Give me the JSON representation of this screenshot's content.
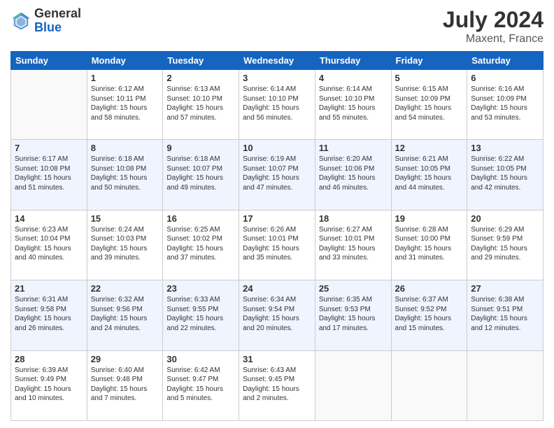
{
  "header": {
    "logo_general": "General",
    "logo_blue": "Blue",
    "month_year": "July 2024",
    "location": "Maxent, France"
  },
  "weekdays": [
    "Sunday",
    "Monday",
    "Tuesday",
    "Wednesday",
    "Thursday",
    "Friday",
    "Saturday"
  ],
  "weeks": [
    [
      {
        "day": "",
        "empty": true
      },
      {
        "day": "1",
        "line1": "Sunrise: 6:12 AM",
        "line2": "Sunset: 10:11 PM",
        "line3": "Daylight: 15 hours",
        "line4": "and 58 minutes."
      },
      {
        "day": "2",
        "line1": "Sunrise: 6:13 AM",
        "line2": "Sunset: 10:10 PM",
        "line3": "Daylight: 15 hours",
        "line4": "and 57 minutes."
      },
      {
        "day": "3",
        "line1": "Sunrise: 6:14 AM",
        "line2": "Sunset: 10:10 PM",
        "line3": "Daylight: 15 hours",
        "line4": "and 56 minutes."
      },
      {
        "day": "4",
        "line1": "Sunrise: 6:14 AM",
        "line2": "Sunset: 10:10 PM",
        "line3": "Daylight: 15 hours",
        "line4": "and 55 minutes."
      },
      {
        "day": "5",
        "line1": "Sunrise: 6:15 AM",
        "line2": "Sunset: 10:09 PM",
        "line3": "Daylight: 15 hours",
        "line4": "and 54 minutes."
      },
      {
        "day": "6",
        "line1": "Sunrise: 6:16 AM",
        "line2": "Sunset: 10:09 PM",
        "line3": "Daylight: 15 hours",
        "line4": "and 53 minutes."
      }
    ],
    [
      {
        "day": "7",
        "line1": "Sunrise: 6:17 AM",
        "line2": "Sunset: 10:08 PM",
        "line3": "Daylight: 15 hours",
        "line4": "and 51 minutes."
      },
      {
        "day": "8",
        "line1": "Sunrise: 6:18 AM",
        "line2": "Sunset: 10:08 PM",
        "line3": "Daylight: 15 hours",
        "line4": "and 50 minutes."
      },
      {
        "day": "9",
        "line1": "Sunrise: 6:18 AM",
        "line2": "Sunset: 10:07 PM",
        "line3": "Daylight: 15 hours",
        "line4": "and 49 minutes."
      },
      {
        "day": "10",
        "line1": "Sunrise: 6:19 AM",
        "line2": "Sunset: 10:07 PM",
        "line3": "Daylight: 15 hours",
        "line4": "and 47 minutes."
      },
      {
        "day": "11",
        "line1": "Sunrise: 6:20 AM",
        "line2": "Sunset: 10:06 PM",
        "line3": "Daylight: 15 hours",
        "line4": "and 46 minutes."
      },
      {
        "day": "12",
        "line1": "Sunrise: 6:21 AM",
        "line2": "Sunset: 10:05 PM",
        "line3": "Daylight: 15 hours",
        "line4": "and 44 minutes."
      },
      {
        "day": "13",
        "line1": "Sunrise: 6:22 AM",
        "line2": "Sunset: 10:05 PM",
        "line3": "Daylight: 15 hours",
        "line4": "and 42 minutes."
      }
    ],
    [
      {
        "day": "14",
        "line1": "Sunrise: 6:23 AM",
        "line2": "Sunset: 10:04 PM",
        "line3": "Daylight: 15 hours",
        "line4": "and 40 minutes."
      },
      {
        "day": "15",
        "line1": "Sunrise: 6:24 AM",
        "line2": "Sunset: 10:03 PM",
        "line3": "Daylight: 15 hours",
        "line4": "and 39 minutes."
      },
      {
        "day": "16",
        "line1": "Sunrise: 6:25 AM",
        "line2": "Sunset: 10:02 PM",
        "line3": "Daylight: 15 hours",
        "line4": "and 37 minutes."
      },
      {
        "day": "17",
        "line1": "Sunrise: 6:26 AM",
        "line2": "Sunset: 10:01 PM",
        "line3": "Daylight: 15 hours",
        "line4": "and 35 minutes."
      },
      {
        "day": "18",
        "line1": "Sunrise: 6:27 AM",
        "line2": "Sunset: 10:01 PM",
        "line3": "Daylight: 15 hours",
        "line4": "and 33 minutes."
      },
      {
        "day": "19",
        "line1": "Sunrise: 6:28 AM",
        "line2": "Sunset: 10:00 PM",
        "line3": "Daylight: 15 hours",
        "line4": "and 31 minutes."
      },
      {
        "day": "20",
        "line1": "Sunrise: 6:29 AM",
        "line2": "Sunset: 9:59 PM",
        "line3": "Daylight: 15 hours",
        "line4": "and 29 minutes."
      }
    ],
    [
      {
        "day": "21",
        "line1": "Sunrise: 6:31 AM",
        "line2": "Sunset: 9:58 PM",
        "line3": "Daylight: 15 hours",
        "line4": "and 26 minutes."
      },
      {
        "day": "22",
        "line1": "Sunrise: 6:32 AM",
        "line2": "Sunset: 9:56 PM",
        "line3": "Daylight: 15 hours",
        "line4": "and 24 minutes."
      },
      {
        "day": "23",
        "line1": "Sunrise: 6:33 AM",
        "line2": "Sunset: 9:55 PM",
        "line3": "Daylight: 15 hours",
        "line4": "and 22 minutes."
      },
      {
        "day": "24",
        "line1": "Sunrise: 6:34 AM",
        "line2": "Sunset: 9:54 PM",
        "line3": "Daylight: 15 hours",
        "line4": "and 20 minutes."
      },
      {
        "day": "25",
        "line1": "Sunrise: 6:35 AM",
        "line2": "Sunset: 9:53 PM",
        "line3": "Daylight: 15 hours",
        "line4": "and 17 minutes."
      },
      {
        "day": "26",
        "line1": "Sunrise: 6:37 AM",
        "line2": "Sunset: 9:52 PM",
        "line3": "Daylight: 15 hours",
        "line4": "and 15 minutes."
      },
      {
        "day": "27",
        "line1": "Sunrise: 6:38 AM",
        "line2": "Sunset: 9:51 PM",
        "line3": "Daylight: 15 hours",
        "line4": "and 12 minutes."
      }
    ],
    [
      {
        "day": "28",
        "line1": "Sunrise: 6:39 AM",
        "line2": "Sunset: 9:49 PM",
        "line3": "Daylight: 15 hours",
        "line4": "and 10 minutes."
      },
      {
        "day": "29",
        "line1": "Sunrise: 6:40 AM",
        "line2": "Sunset: 9:48 PM",
        "line3": "Daylight: 15 hours",
        "line4": "and 7 minutes."
      },
      {
        "day": "30",
        "line1": "Sunrise: 6:42 AM",
        "line2": "Sunset: 9:47 PM",
        "line3": "Daylight: 15 hours",
        "line4": "and 5 minutes."
      },
      {
        "day": "31",
        "line1": "Sunrise: 6:43 AM",
        "line2": "Sunset: 9:45 PM",
        "line3": "Daylight: 15 hours",
        "line4": "and 2 minutes."
      },
      {
        "day": "",
        "empty": true
      },
      {
        "day": "",
        "empty": true
      },
      {
        "day": "",
        "empty": true
      }
    ]
  ]
}
